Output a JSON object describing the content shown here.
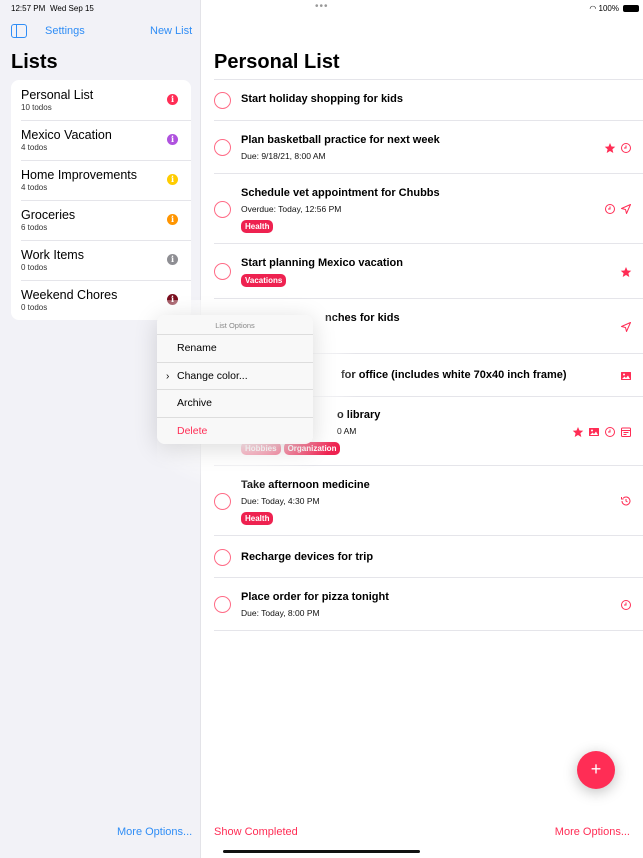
{
  "status": {
    "time": "12:57 PM",
    "date": "Wed Sep 15",
    "battery": "100%"
  },
  "sidebar": {
    "settings": "Settings",
    "new_list": "New List",
    "title": "Lists",
    "more": "More Options...",
    "lists": [
      {
        "name": "Personal List",
        "count": "10 todos",
        "color": "#ff2d55"
      },
      {
        "name": "Mexico Vacation",
        "count": "4 todos",
        "color": "#af52de"
      },
      {
        "name": "Home Improvements",
        "count": "4 todos",
        "color": "#ffcc00"
      },
      {
        "name": "Groceries",
        "count": "6 todos",
        "color": "#ff9500"
      },
      {
        "name": "Work Items",
        "count": "0 todos",
        "color": "#8e8e93"
      },
      {
        "name": "Weekend Chores",
        "count": "0 todos",
        "color": "#7a0f1f"
      }
    ]
  },
  "main": {
    "title": "Personal List",
    "show_completed": "Show Completed",
    "more": "More Options...",
    "add": "+",
    "todos": [
      {
        "title": "Start holiday shopping for kids",
        "subtitle": "",
        "tags": [],
        "icons": []
      },
      {
        "title": "Plan basketball practice for next week",
        "subtitle": "Due: 9/18/21, 8:00 AM",
        "tags": [],
        "icons": [
          "star-icon",
          "clock-icon"
        ]
      },
      {
        "title": "Schedule vet appointment for Chubbs",
        "subtitle": "Overdue: Today, 12:56 PM",
        "tags": [
          "Health"
        ],
        "icons": [
          "clock-icon",
          "location-icon"
        ]
      },
      {
        "title": "Start planning Mexico vacation",
        "subtitle": "",
        "tags": [
          "Vacations"
        ],
        "icons": [
          "star-icon"
        ]
      },
      {
        "title": "nches for kids",
        "subtitle": "",
        "tags": [],
        "icons": [
          "location-icon"
        ]
      },
      {
        "title": "for office (includes white 70x40 inch frame)",
        "subtitle": "",
        "tags": [],
        "icons": [
          "image-icon"
        ]
      },
      {
        "title": "o library",
        "subtitle": "0 AM",
        "tags": [
          "Hobbies",
          "Organization"
        ],
        "icons": [
          "star-icon",
          "image-icon",
          "clock-icon",
          "calendar-icon"
        ]
      },
      {
        "title": "Take afternoon medicine",
        "subtitle": "Due: Today, 4:30 PM",
        "tags": [
          "Health"
        ],
        "icons": [
          "history-icon"
        ]
      },
      {
        "title": "Recharge devices for trip",
        "subtitle": "",
        "tags": [],
        "icons": []
      },
      {
        "title": "Place order for pizza tonight",
        "subtitle": "Due: Today, 8:00 PM",
        "tags": [],
        "icons": [
          "clock-icon"
        ]
      }
    ]
  },
  "menu": {
    "header": "List Options",
    "items": [
      "Rename",
      "Change color...",
      "Archive",
      "Delete"
    ]
  },
  "accent": "#ff2d55"
}
